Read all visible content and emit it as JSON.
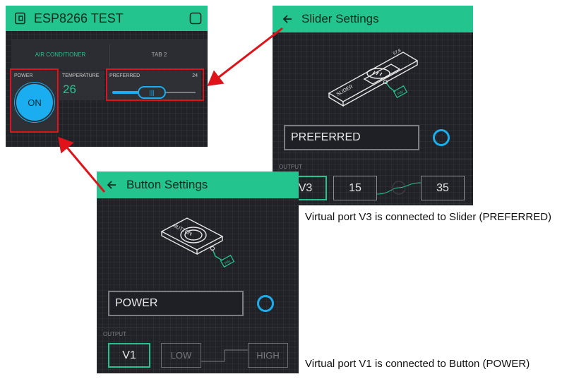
{
  "app": {
    "title": "ESP8266 TEST",
    "tabs": [
      "AIR CONDITIONER",
      "TAB 2"
    ],
    "power": {
      "label": "POWER",
      "button_text": "ON"
    },
    "temperature": {
      "label": "TEMPERATURE",
      "value": "26"
    },
    "preferred": {
      "label": "PREFERRED",
      "value": "24"
    }
  },
  "slider_settings": {
    "title": "Slider Settings",
    "name_value": "PREFERRED",
    "output_label": "OUTPUT",
    "pin": "V3",
    "min": "15",
    "max": "35",
    "illustration": {
      "label": "SLIDER",
      "small_value": "57.6",
      "pin_tag": "PIN"
    }
  },
  "button_settings": {
    "title": "Button Settings",
    "name_value": "POWER",
    "output_label": "OUTPUT",
    "pin": "V1",
    "low": "LOW",
    "high": "HIGH",
    "illustration": {
      "label": "BUTTON",
      "pin_tag": "PIN"
    }
  },
  "captions": {
    "slider": "Virtual port V3 is connected to Slider (PREFERRED)",
    "button": "Virtual port V1 is connected to Button (POWER)"
  },
  "colors": {
    "accent": "#23c48e",
    "panel": "#212227",
    "highlight": "#e0131a",
    "ring": "#1aaef0"
  }
}
